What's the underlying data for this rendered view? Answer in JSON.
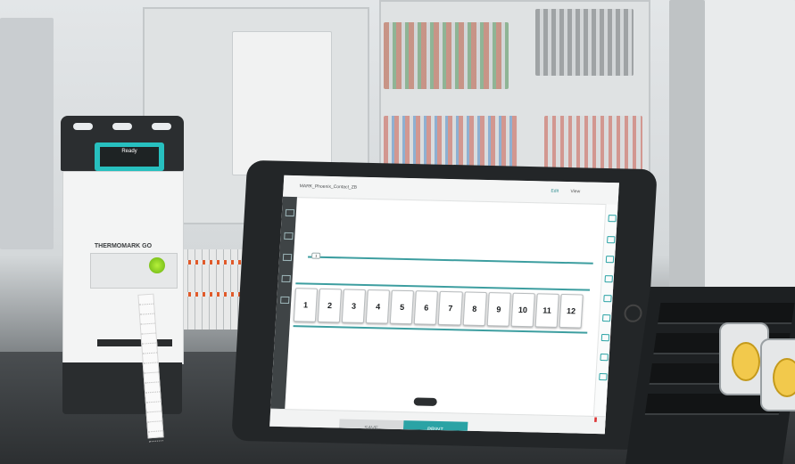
{
  "printer": {
    "brand": "THERMOMARK GO",
    "display_value": "Ready"
  },
  "tablet": {
    "app": {
      "document_title": "MARK_Phoenix_Contact_ZB",
      "edit_label": "Edit",
      "view_label": "View",
      "tag_text": "1",
      "markers": [
        "1",
        "2",
        "3",
        "4",
        "5",
        "6",
        "7",
        "8",
        "9",
        "10",
        "11",
        "12"
      ],
      "save_label": "SAVE",
      "print_label": "PRINT"
    }
  },
  "colors": {
    "accent": "#2aa3a5",
    "printer_led": "#8fd22a",
    "device_dark": "#2a2d2f"
  }
}
